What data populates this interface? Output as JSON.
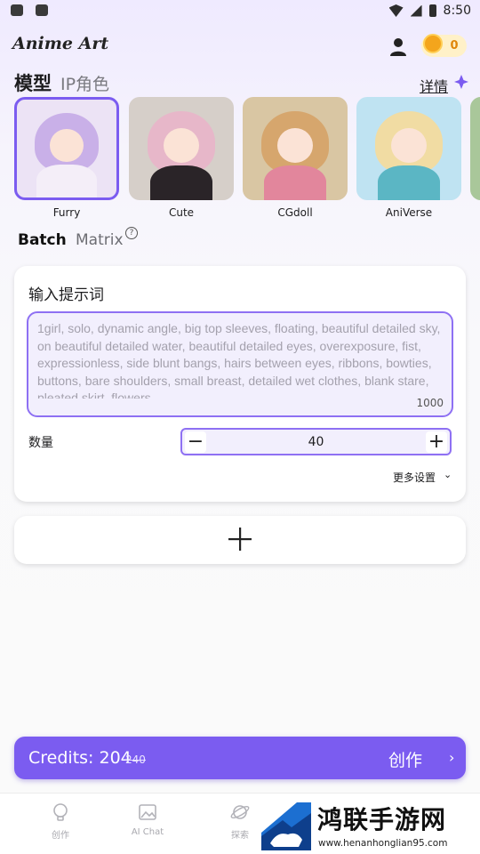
{
  "status_bar": {
    "time": "8:50"
  },
  "header": {
    "app_title": "Anime Art",
    "coin_count": "0"
  },
  "tabs": {
    "model": "模型",
    "ip_character": "IP角色",
    "detail_link": "详情"
  },
  "models": [
    {
      "label": "Furry",
      "selected": true,
      "hair": "#c9b0e8",
      "outfit": "#f4eef8",
      "bg": "#ece3f5"
    },
    {
      "label": "Cute",
      "selected": false,
      "hair": "#e7b7c9",
      "outfit": "#2a2428",
      "bg": "#d6cfc9"
    },
    {
      "label": "CGdoll",
      "selected": false,
      "hair": "#d6a66d",
      "outfit": "#e2869c",
      "bg": "#d9c6a3"
    },
    {
      "label": "AniVerse",
      "selected": false,
      "hair": "#f1dca3",
      "outfit": "#5bb6c4",
      "bg": "#bfe3f2"
    }
  ],
  "mode_tabs": {
    "batch": "Batch",
    "matrix": "Matrix",
    "help_symbol": "?"
  },
  "prompt_card": {
    "title": "输入提示词",
    "placeholder": "1girl, solo, dynamic angle, big top sleeves, floating, beautiful detailed sky, on beautiful detailed water, beautiful detailed eyes, overexposure, fist, expressionless, side blunt bangs, hairs between eyes, ribbons, bowties, buttons, bare shoulders, small breast, detailed wet clothes, blank stare, pleated skirt, flowers",
    "char_limit": "1000",
    "quantity_label": "数量",
    "quantity_value": "40",
    "minus_symbol": "−",
    "plus_symbol": "+",
    "more_settings": "更多设置"
  },
  "credits_bar": {
    "credits_text": "Credits: 204",
    "old_credits": "240",
    "create_label": "创作"
  },
  "bottom_nav": {
    "items": [
      {
        "label": "创作",
        "icon": "bulb-icon"
      },
      {
        "label": "AI Chat",
        "icon": "image-chat-icon"
      },
      {
        "label": "探索",
        "icon": "planet-icon"
      }
    ]
  },
  "watermark": {
    "name": "鸿联手游网",
    "url": "www.henanhonglian95.com"
  },
  "colors": {
    "accent": "#7b5cf0",
    "coin": "#f4a51c"
  }
}
